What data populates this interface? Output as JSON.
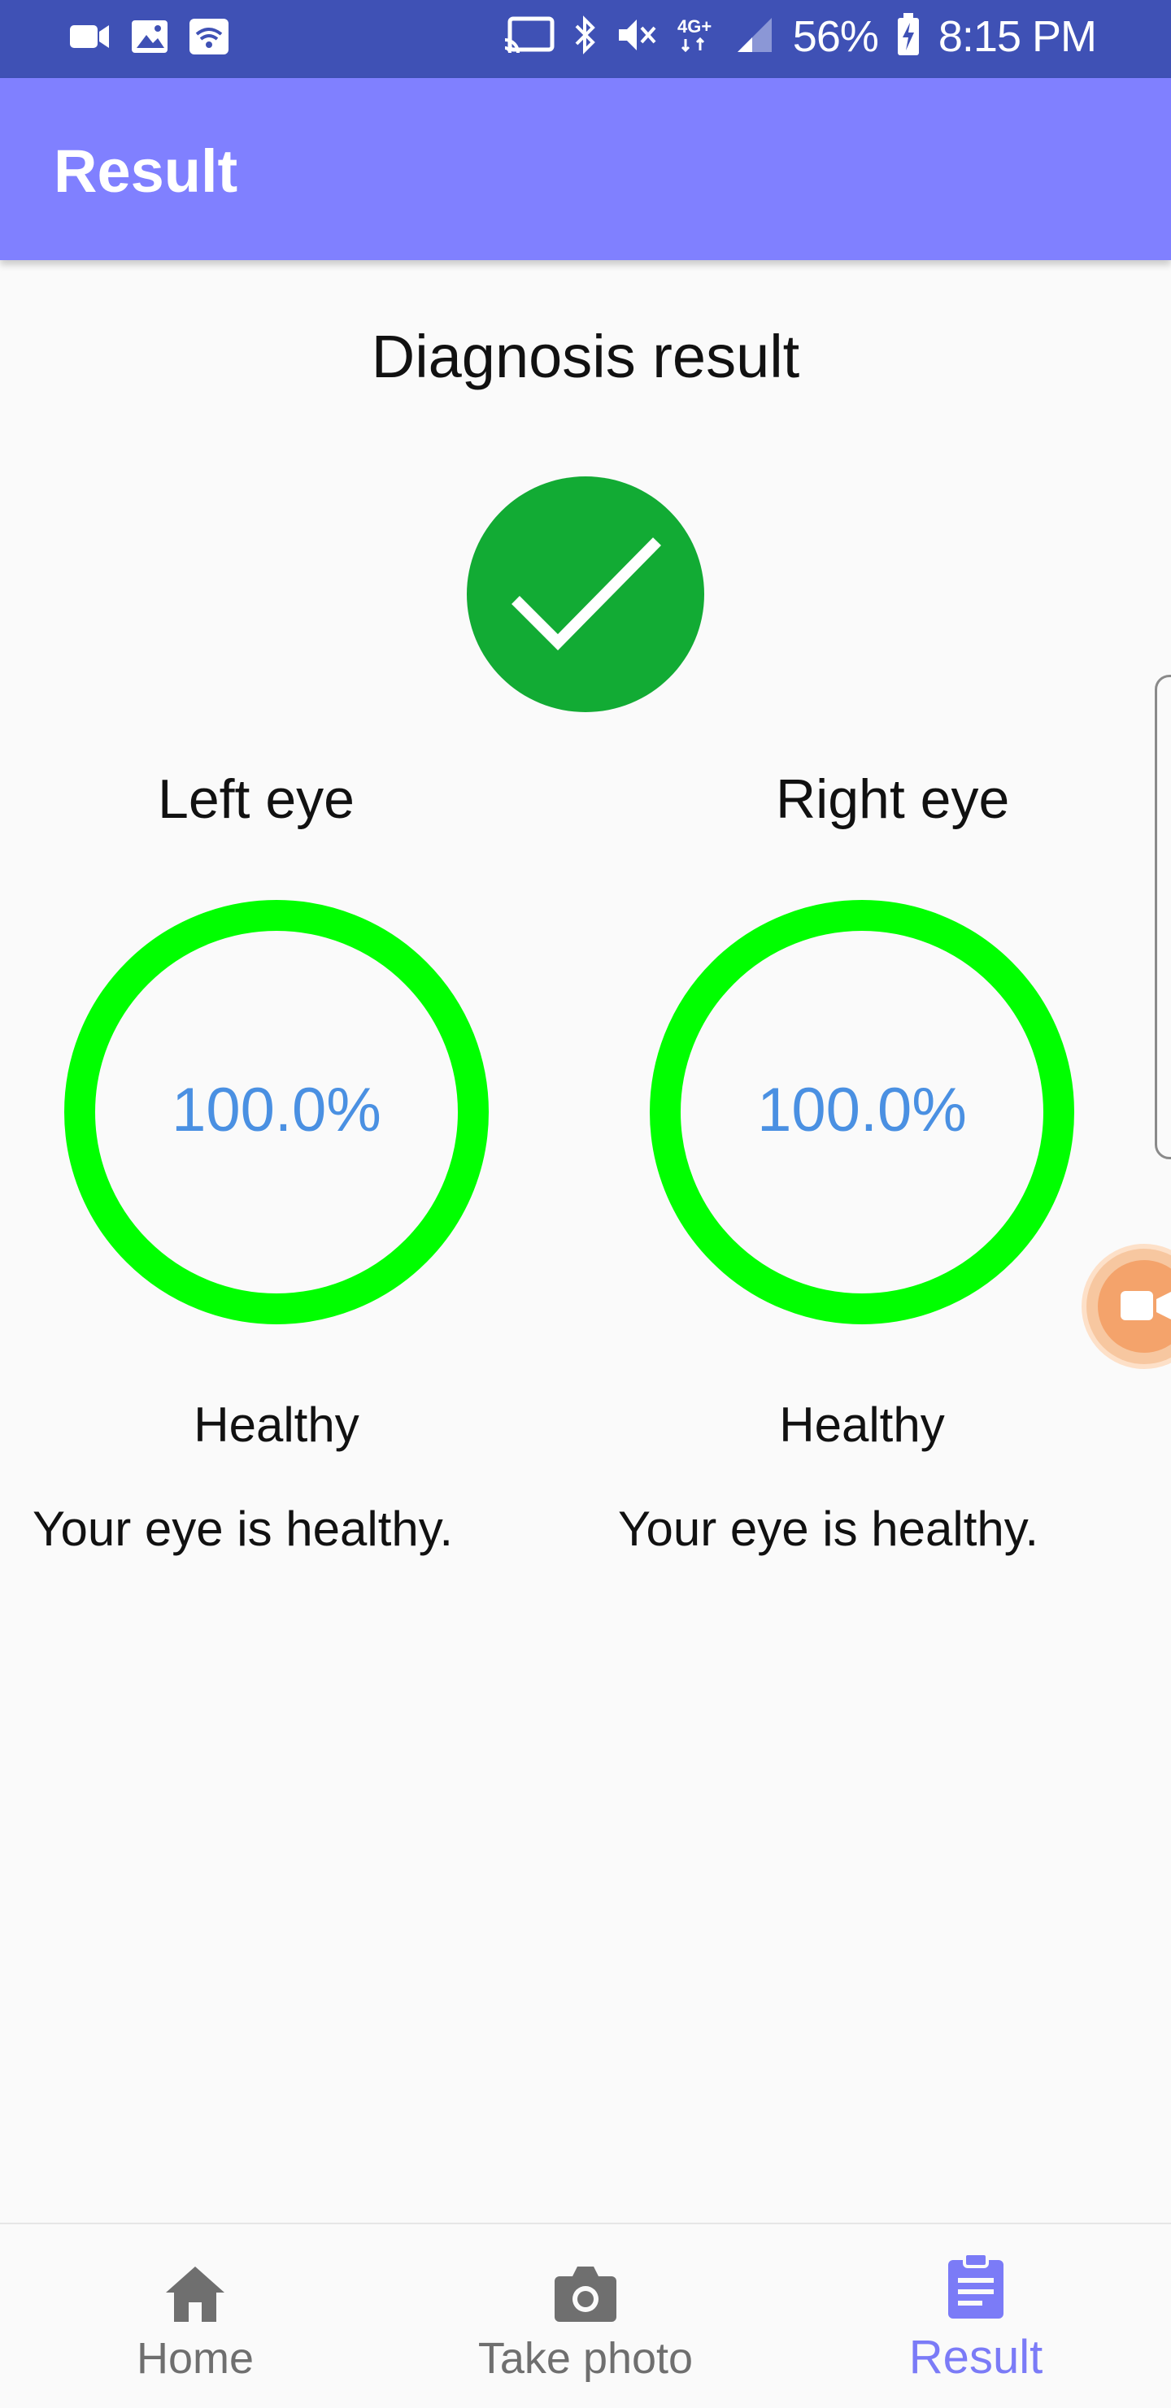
{
  "status_bar": {
    "battery": "56%",
    "time": "8:15 PM",
    "network": "4G+",
    "left_icons": [
      "video-camera-icon",
      "image-icon",
      "wifi-hotspot-icon"
    ],
    "right_icons": [
      "cast-icon",
      "bluetooth-icon",
      "mute-icon",
      "network-4g-icon",
      "signal-icon",
      "battery-charging-icon"
    ]
  },
  "app_bar": {
    "title": "Result"
  },
  "diagnosis": {
    "title": "Diagnosis result",
    "status_icon": "check-icon",
    "status_color": "#12ab34"
  },
  "eyes": {
    "left": {
      "label": "Left eye",
      "percent": "100.0%",
      "percent_value": 100.0,
      "status": "Healthy",
      "description": "Your eye is healthy."
    },
    "right": {
      "label": "Right eye",
      "percent": "100.0%",
      "percent_value": 100.0,
      "status": "Healthy",
      "description": "Your eye is healthy."
    }
  },
  "colors": {
    "status_bar": "#3f51b5",
    "app_bar": "#8080ff",
    "ring": "#00ff00",
    "percent_text": "#4a90e2",
    "nav_active": "#7b7bf7",
    "nav_inactive": "#6f6f6f"
  },
  "bottom_nav": {
    "items": [
      {
        "label": "Home",
        "icon": "home-icon",
        "active": false
      },
      {
        "label": "Take photo",
        "icon": "camera-icon",
        "active": false
      },
      {
        "label": "Result",
        "icon": "clipboard-icon",
        "active": true
      }
    ]
  }
}
